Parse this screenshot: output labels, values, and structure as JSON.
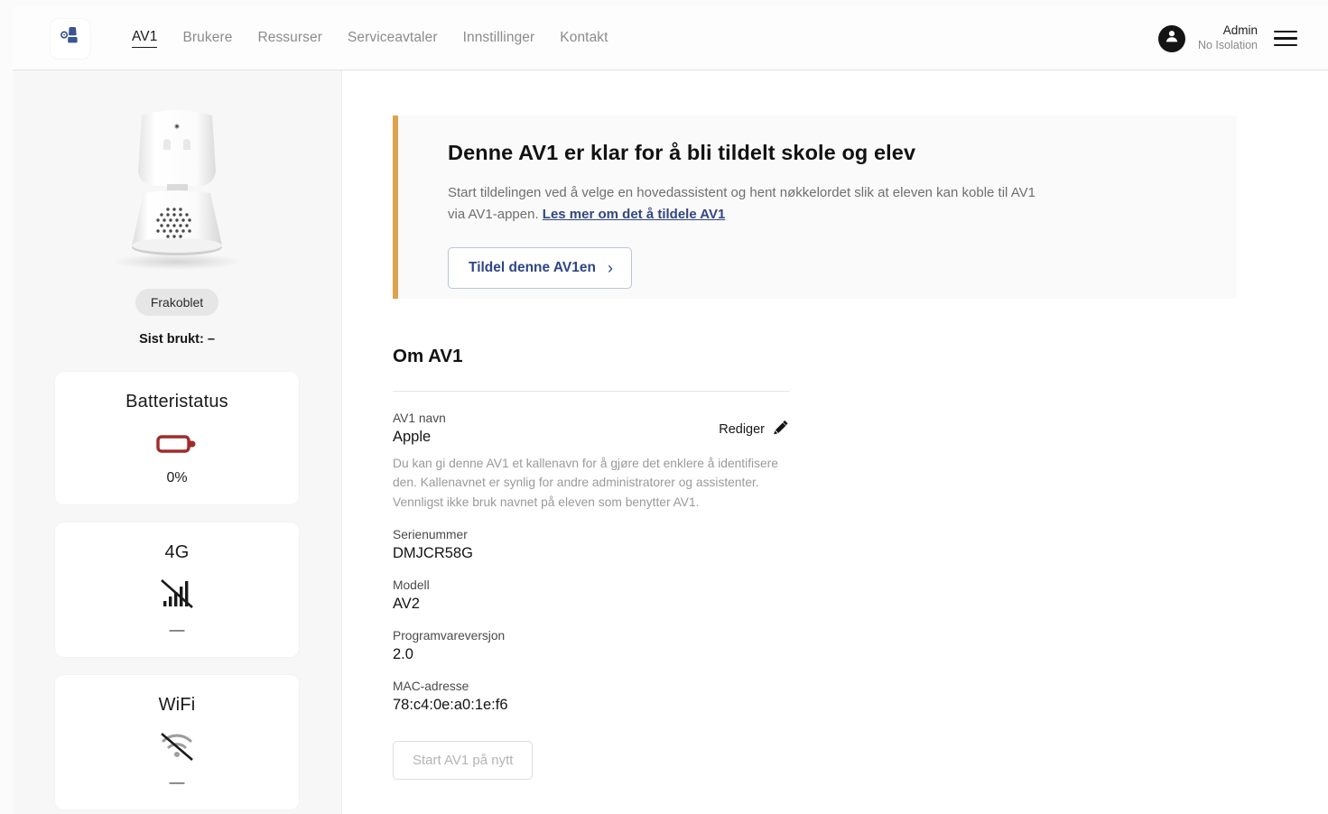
{
  "header": {
    "logo_icon": "av1-robot-logo-icon",
    "nav": [
      {
        "label": "AV1",
        "active": true
      },
      {
        "label": "Brukere",
        "active": false
      },
      {
        "label": "Ressurser",
        "active": false
      },
      {
        "label": "Serviceavtaler",
        "active": false
      },
      {
        "label": "Innstillinger",
        "active": false
      },
      {
        "label": "Kontakt",
        "active": false
      }
    ],
    "user": {
      "name": "Admin",
      "org": "No Isolation"
    },
    "avatar_icon": "user-avatar-icon",
    "menu_icon": "hamburger-menu-icon"
  },
  "sidebar": {
    "robot_image_alt": "av1-robot-photo",
    "status_badge": "Frakoblet",
    "last_used": "Sist brukt: –",
    "cards": [
      {
        "title": "Batteristatus",
        "icon": "battery-empty-icon",
        "value": "0%",
        "color": "#a02b2b"
      },
      {
        "title": "4G",
        "icon": "cellular-signal-off-icon",
        "value": "—",
        "color": "#1a1a1a"
      },
      {
        "title": "WiFi",
        "icon": "wifi-off-icon",
        "value": "—",
        "color": "#9e9e9e"
      }
    ]
  },
  "main": {
    "banner": {
      "accent_color": "#dfa24e",
      "title": "Denne AV1 er klar for å bli tildelt skole og elev",
      "body_text": "Start tildelingen ved å velge en hovedassistent og hent nøkkelordet slik at eleven kan koble til AV1 via AV1-appen. ",
      "link_text": "Les mer om det å tildele AV1",
      "button_label": "Tildel denne AV1en",
      "button_chevron": "chevron-right-icon"
    },
    "section_title": "Om AV1",
    "edit_label": "Rediger",
    "edit_icon": "pencil-icon",
    "fields": [
      {
        "label": "AV1 navn",
        "value": "Apple",
        "help": "Du kan gi denne AV1 et kallenavn for å gjøre det enklere å identifisere den. Kallenavnet er synlig for andre administratorer og assistenter. Vennligst ikke bruk navnet på eleven som benytter AV1."
      },
      {
        "label": "Serienummer",
        "value": "DMJCR58G",
        "help": ""
      },
      {
        "label": "Modell",
        "value": "AV2",
        "help": ""
      },
      {
        "label": "Programvareversjon",
        "value": "2.0",
        "help": ""
      },
      {
        "label": "MAC-adresse",
        "value": "78:c4:0e:a0:1e:f6",
        "help": ""
      }
    ],
    "restart_button_label": "Start AV1 på nytt"
  }
}
